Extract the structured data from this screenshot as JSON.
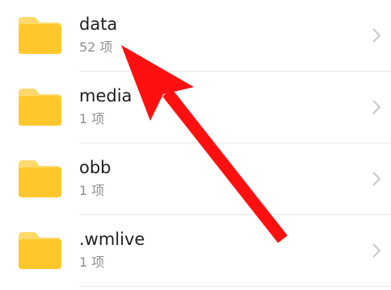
{
  "folders": [
    {
      "name": "data",
      "count": "52 项"
    },
    {
      "name": "media",
      "count": "1 项"
    },
    {
      "name": "obb",
      "count": "1 项"
    },
    {
      "name": ".wmlive",
      "count": "1 项"
    }
  ],
  "colors": {
    "folder_body": "#FFC72C",
    "folder_tab": "#FFD96A",
    "arrow": "#FF1010",
    "name_text": "#1F1F1F",
    "count_text": "#8F8F8F",
    "chevron": "#C8C8C8",
    "divider": "#E8E8E8"
  },
  "icons": {
    "folder": "folder-icon",
    "chevron": "chevron-right-icon",
    "annotation": "red-arrow-pointer"
  }
}
